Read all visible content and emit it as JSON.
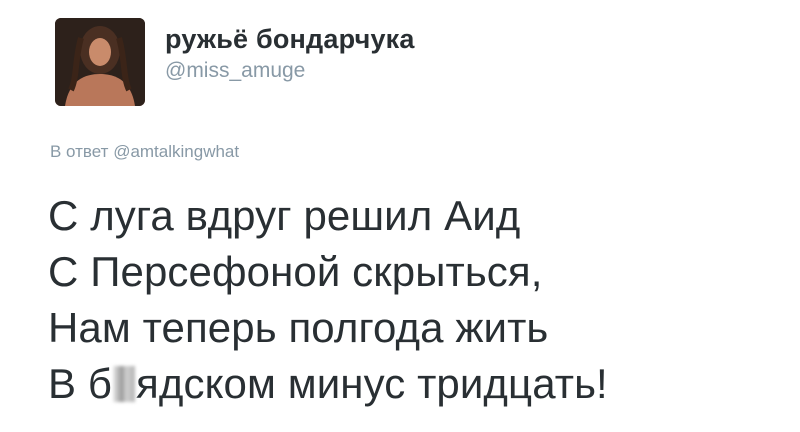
{
  "user": {
    "display_name": "ружьё бондарчука",
    "handle": "@miss_amuge",
    "avatar_icon": "profile-photo"
  },
  "reply": {
    "prefix": "В ответ",
    "mention": "@amtalkingwhat"
  },
  "tweet": {
    "lines": [
      "С луга вдруг решил Аид",
      "С Персефоной скрыться,",
      "Нам теперь полгода жить"
    ],
    "last_line_start": "В б",
    "last_line_end": "ядском минус тридцать!"
  },
  "colors": {
    "text": "#292f33",
    "secondary": "#8899a6"
  }
}
